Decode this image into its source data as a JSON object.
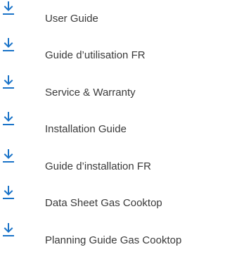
{
  "accent_color": "#1a73c8",
  "documents": [
    {
      "label": "User Guide",
      "icon": "download-icon"
    },
    {
      "label": "Guide d’utilisation FR",
      "icon": "download-icon"
    },
    {
      "label": "Service & Warranty",
      "icon": "download-icon"
    },
    {
      "label": "Installation Guide",
      "icon": "download-icon"
    },
    {
      "label": "Guide d’installation FR",
      "icon": "download-icon"
    },
    {
      "label": "Data Sheet Gas Cooktop",
      "icon": "download-icon"
    },
    {
      "label": "Planning Guide Gas Cooktop",
      "icon": "download-icon"
    }
  ]
}
